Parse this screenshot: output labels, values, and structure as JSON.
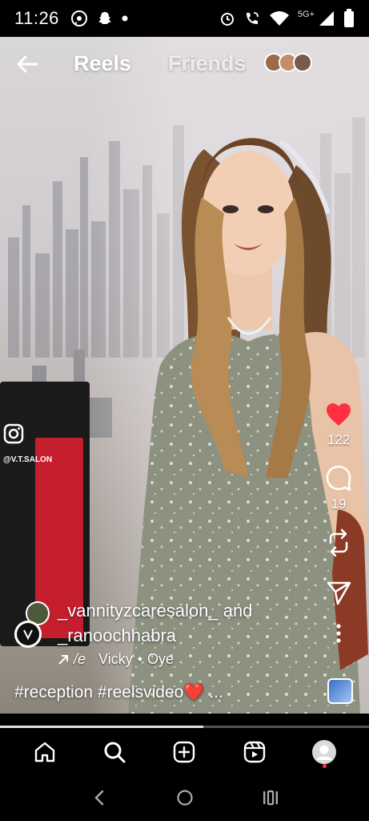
{
  "status_bar": {
    "time": "11:26",
    "network_label": "5G+",
    "left_icons": [
      "whatsapp-icon",
      "snapchat-icon",
      "dot-icon"
    ],
    "right_icons": [
      "alarm-icon",
      "wifi-calling-icon",
      "wifi-icon",
      "signal-icon",
      "battery-icon"
    ]
  },
  "reel": {
    "tabs": {
      "reels": "Reels",
      "friends": "Friends"
    },
    "watermark": "@V.T.SALON",
    "author": {
      "primary": "_vannityzcaresalon_",
      "connector": "and",
      "secondary": "_ranoochhabra"
    },
    "audio": {
      "prefix": "/e",
      "artist": "Vicky",
      "separator": "•",
      "title": "Oye"
    },
    "caption": "#reception #reelsvideo❤️ ...",
    "actions": {
      "like_count": "122",
      "comment_count": "19"
    },
    "like_color": "#ff3040",
    "progress": 0.55
  },
  "bottom_nav": {
    "items": [
      "home-icon",
      "search-icon",
      "create-icon",
      "reels-icon",
      "profile-avatar"
    ]
  },
  "system_nav": {
    "items": [
      "back-icon",
      "home-circle-icon",
      "recents-icon"
    ]
  }
}
